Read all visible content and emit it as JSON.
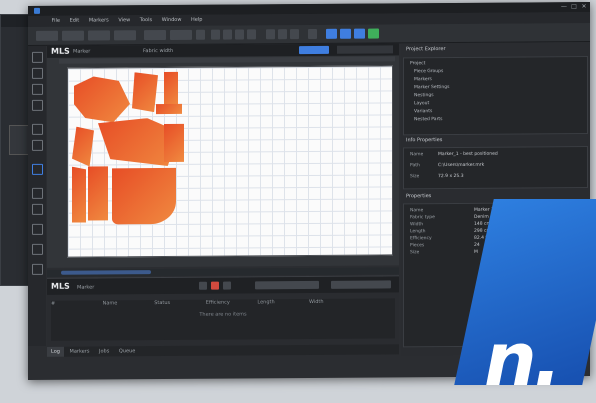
{
  "app": {
    "title": ""
  },
  "menu": [
    "File",
    "Edit",
    "Markers",
    "View",
    "Tools",
    "Window",
    "Help"
  ],
  "editor": {
    "logo": "MLS",
    "tab_label": "Marker",
    "field_label": "Fabric width"
  },
  "log": {
    "logo": "MLS",
    "tab_label": "Marker",
    "columns": [
      "#",
      "Name",
      "Status",
      "Efficiency",
      "Length",
      "Width"
    ],
    "empty": "There are no items"
  },
  "tabs": [
    "Log",
    "Markers",
    "Jobs",
    "Queue"
  ],
  "right": {
    "explorer_title": "Project Explorer",
    "tree": [
      "Project",
      "Piece Groups",
      "Markers",
      "Marker Settings",
      "Nestings",
      "Layout",
      "Variants",
      "Nested Parts"
    ],
    "info_title": "Info Properties",
    "info_rows": [
      [
        "Name",
        "Marker_1 - best positioned"
      ],
      [
        "Path",
        "C:\\Users\\marker.mrk"
      ],
      [
        "Size",
        "72.9 x 25.3"
      ]
    ],
    "props_title": "Properties",
    "props_rows": [
      [
        "Name",
        "Marker 1"
      ],
      [
        "Fabric type",
        "Denim"
      ],
      [
        "Width",
        "148 cm"
      ],
      [
        "Length",
        "298 cm"
      ],
      [
        "Efficiency",
        "82.4 %"
      ],
      [
        "Pieces",
        "24"
      ],
      [
        "Size",
        "M"
      ]
    ]
  },
  "brand": {
    "text": "n."
  },
  "colors": {
    "accent": "#3f7ee0",
    "piece": "#e85a2a",
    "brand": "#1f66c8"
  }
}
